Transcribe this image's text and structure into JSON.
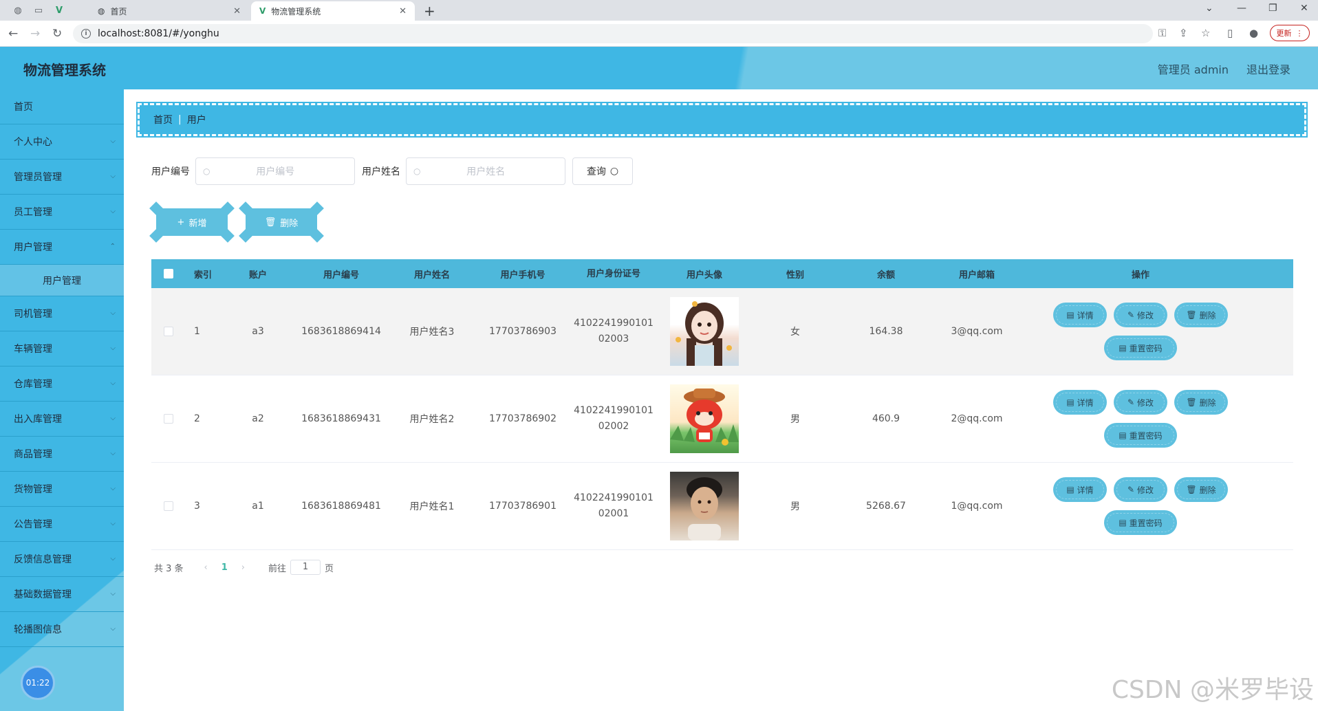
{
  "browser": {
    "tabs": [
      {
        "label": "首页"
      },
      {
        "label": "物流管理系统"
      }
    ],
    "url": "localhost:8081/#/yonghu",
    "update_label": "更新"
  },
  "header": {
    "title": "物流管理系统",
    "user": "管理员 admin",
    "logout": "退出登录"
  },
  "sidebar": {
    "items": [
      {
        "label": "首页"
      },
      {
        "label": "个人中心"
      },
      {
        "label": "管理员管理"
      },
      {
        "label": "员工管理"
      },
      {
        "label": "用户管理"
      },
      {
        "label": "用户管理"
      },
      {
        "label": "司机管理"
      },
      {
        "label": "车辆管理"
      },
      {
        "label": "仓库管理"
      },
      {
        "label": "出入库管理"
      },
      {
        "label": "商品管理"
      },
      {
        "label": "货物管理"
      },
      {
        "label": "公告管理"
      },
      {
        "label": "反馈信息管理"
      },
      {
        "label": "基础数据管理"
      },
      {
        "label": "轮播图信息"
      }
    ],
    "clock": "01:22"
  },
  "breadcrumb": {
    "home": "首页",
    "current": "用户"
  },
  "search": {
    "no_label": "用户编号",
    "no_placeholder": "用户编号",
    "name_label": "用户姓名",
    "name_placeholder": "用户姓名",
    "query_label": "查询"
  },
  "actions": {
    "add": "新增",
    "delete": "删除"
  },
  "table": {
    "headers": [
      "索引",
      "账户",
      "用户编号",
      "用户姓名",
      "用户手机号",
      "用户身份证号",
      "用户头像",
      "性别",
      "余额",
      "用户邮箱",
      "操作"
    ],
    "rows": [
      {
        "index": "1",
        "account": "a3",
        "no": "1683618869414",
        "name": "用户姓名3",
        "phone": "17703786903",
        "id_line1": "4102241990101",
        "id_line2": "02003",
        "sex": "女",
        "balance": "164.38",
        "email": "3@qq.com"
      },
      {
        "index": "2",
        "account": "a2",
        "no": "1683618869431",
        "name": "用户姓名2",
        "phone": "17703786902",
        "id_line1": "4102241990101",
        "id_line2": "02002",
        "sex": "男",
        "balance": "460.9",
        "email": "2@qq.com"
      },
      {
        "index": "3",
        "account": "a1",
        "no": "1683618869481",
        "name": "用户姓名1",
        "phone": "17703786901",
        "id_line1": "4102241990101",
        "id_line2": "02001",
        "sex": "男",
        "balance": "5268.67",
        "email": "1@qq.com"
      }
    ],
    "ops": {
      "detail": "详情",
      "edit": "修改",
      "delete": "删除",
      "reset": "重置密码"
    }
  },
  "pager": {
    "total": "共 3 条",
    "current": "1",
    "goto": "前往",
    "page_input": "1",
    "page_unit": "页"
  },
  "watermark": "CSDN @米罗毕设"
}
